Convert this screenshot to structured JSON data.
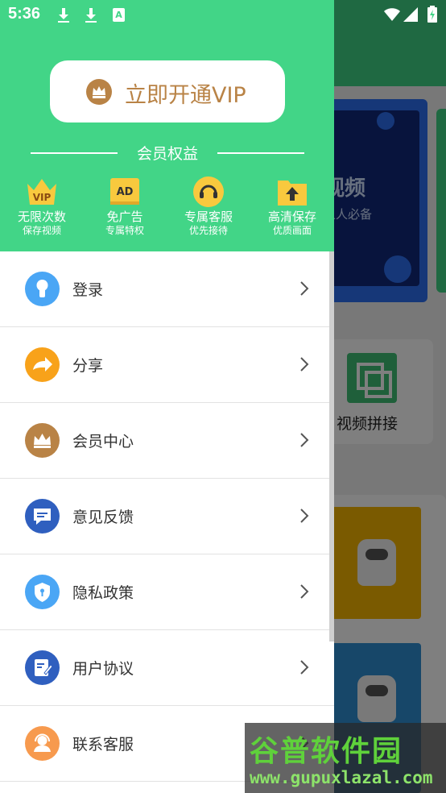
{
  "status_bar": {
    "time": "5:36",
    "notification_icons": [
      "download-icon",
      "download-icon",
      "a-icon"
    ],
    "a_icon_text": "A"
  },
  "background": {
    "banner_title": "视频",
    "banner_subtitle": "人人必备",
    "card_label": "视频拼接"
  },
  "drawer": {
    "vip_button_label": "立即开通VIP",
    "benefits_title": "会员权益",
    "benefits": [
      {
        "name": "无限次数",
        "sub": "保存视频",
        "icon": "vip-crown-icon",
        "icon_text": "VIP"
      },
      {
        "name": "免广告",
        "sub": "专属特权",
        "icon": "ad-icon",
        "icon_text": "AD"
      },
      {
        "name": "专属客服",
        "sub": "优先接待",
        "icon": "headset-icon"
      },
      {
        "name": "高清保存",
        "sub": "优质画面",
        "icon": "folder-upload-icon"
      }
    ],
    "menu": [
      {
        "label": "登录",
        "icon": "keyhole-icon",
        "color": "#4aa6f5"
      },
      {
        "label": "分享",
        "icon": "share-arrow-icon",
        "color": "#f8a21a"
      },
      {
        "label": "会员中心",
        "icon": "crown-icon",
        "color": "#b98346"
      },
      {
        "label": "意见反馈",
        "icon": "feedback-icon",
        "color": "#2f5fbf"
      },
      {
        "label": "隐私政策",
        "icon": "shield-icon",
        "color": "#4aa6f5"
      },
      {
        "label": "用户协议",
        "icon": "agreement-icon",
        "color": "#2f5fbf"
      },
      {
        "label": "联系客服",
        "icon": "customer-service-icon",
        "color": "#f79a4e"
      }
    ]
  },
  "watermark": {
    "main": "谷普软件园",
    "url": "www.gupuxlazal.com"
  },
  "colors": {
    "header_green": "#42d587",
    "vip_gold": "#b98346"
  }
}
